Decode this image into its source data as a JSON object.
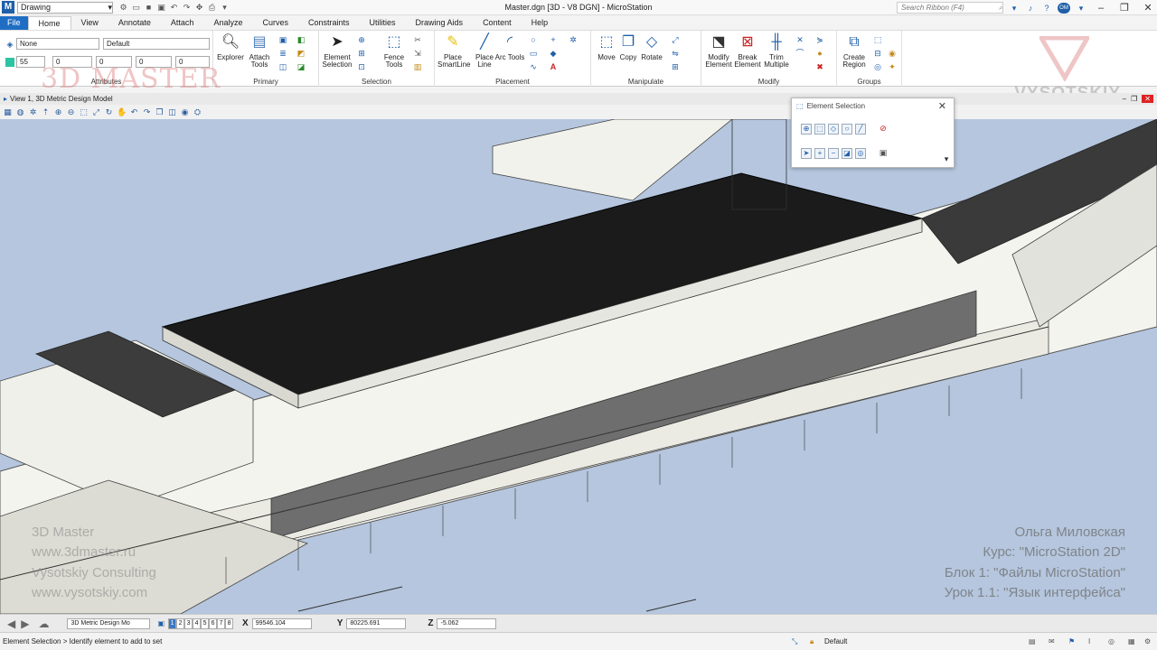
{
  "titlebar": {
    "workspace_value": "Drawing",
    "window_title": "Master.dgn [3D - V8 DGN] - MicroStation",
    "search_placeholder": "Search Ribbon (F4)",
    "user_initials": "OM"
  },
  "tabs": [
    "File",
    "Home",
    "View",
    "Annotate",
    "Attach",
    "Analyze",
    "Curves",
    "Constraints",
    "Utilities",
    "Drawing Aids",
    "Content",
    "Help"
  ],
  "active_tab": "Home",
  "ribbon": {
    "attributes": {
      "label": "Attributes",
      "level_value": "None",
      "style_value": "Default",
      "color_value": "55",
      "weight_value": "0",
      "linestyle_value": "0",
      "transparency_value": "0",
      "priority_value": "0"
    },
    "primary": {
      "label": "Primary",
      "explorer": "Explorer",
      "attach_tools": "Attach Tools"
    },
    "selection": {
      "label": "Selection",
      "element_selection": "Element Selection",
      "fence_tools": "Fence Tools"
    },
    "placement": {
      "label": "Placement",
      "place_smartline": "Place SmartLine",
      "place_line": "Place Line",
      "arc_tools": "Arc Tools"
    },
    "manipulate": {
      "label": "Manipulate",
      "move": "Move",
      "copy": "Copy",
      "rotate": "Rotate"
    },
    "modify": {
      "label": "Modify",
      "modify_element": "Modify Element",
      "break_element": "Break Element",
      "trim_multiple": "Trim Multiple"
    },
    "groups": {
      "label": "Groups",
      "create_region": "Create Region"
    }
  },
  "view": {
    "title": "View 1, 3D Metric Design Model"
  },
  "element_selection_dialog": {
    "title": "Element Selection"
  },
  "watermark": {
    "brand_3dmaster": "3D MASTER",
    "brand_vysotskiy": "VYSOTSKIY",
    "author": "Ольга Миловская",
    "course": "Курс: \"MicroStation 2D\"",
    "block": "Блок 1: \"Файлы MicroStation\"",
    "lesson": "Урок 1.1: \"Язык интерфейса\"",
    "left_lines": [
      "3D Master",
      "www.3dmaster.ru",
      "Vysotskiy Consulting",
      "www.vysotskiy.com"
    ]
  },
  "coordinates": {
    "model": "3D Metric Design Mo",
    "views": [
      "1",
      "2",
      "3",
      "4",
      "5",
      "6",
      "7",
      "8"
    ],
    "active_view": "1",
    "x_label": "X",
    "x_value": "99546.104",
    "y_label": "Y",
    "y_value": "80225.691",
    "z_label": "Z",
    "z_value": "-5.062"
  },
  "status": {
    "prompt": "Element Selection > Identify element to add to set",
    "active_level": "Default"
  },
  "colors": {
    "file_tab": "#1f6ec4",
    "view_background": "#b5c6de",
    "accent": "#1f5fa8"
  }
}
